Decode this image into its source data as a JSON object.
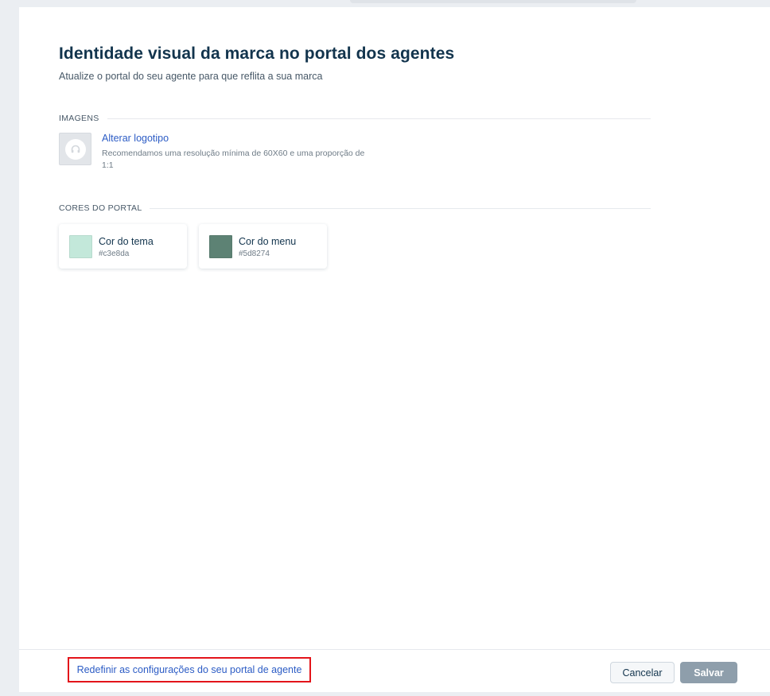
{
  "page": {
    "title": "Identidade visual da marca no portal dos agentes",
    "subtitle": "Atualize o portal do seu agente para que reflita a sua marca"
  },
  "images_section": {
    "label": "IMAGENS",
    "change_logo_label": "Alterar logotipo",
    "hint": "Recomendamos uma resolução mínima de 60X60 e uma proporção de 1:1",
    "logo_icon": "headset-icon"
  },
  "colors_section": {
    "label": "CORES DO PORTAL",
    "cards": [
      {
        "name": "Cor do tema",
        "hex": "#c3e8da",
        "color": "#c3e8da"
      },
      {
        "name": "Cor do menu",
        "hex": "#5d8274",
        "color": "#5d8274"
      }
    ]
  },
  "footer": {
    "reset_label": "Redefinir as configurações do seu portal de agente",
    "cancel_label": "Cancelar",
    "save_label": "Salvar"
  },
  "colors": {
    "link": "#2c5cc5",
    "highlight_border": "#e3141a",
    "save_disabled": "#8e9eab"
  }
}
